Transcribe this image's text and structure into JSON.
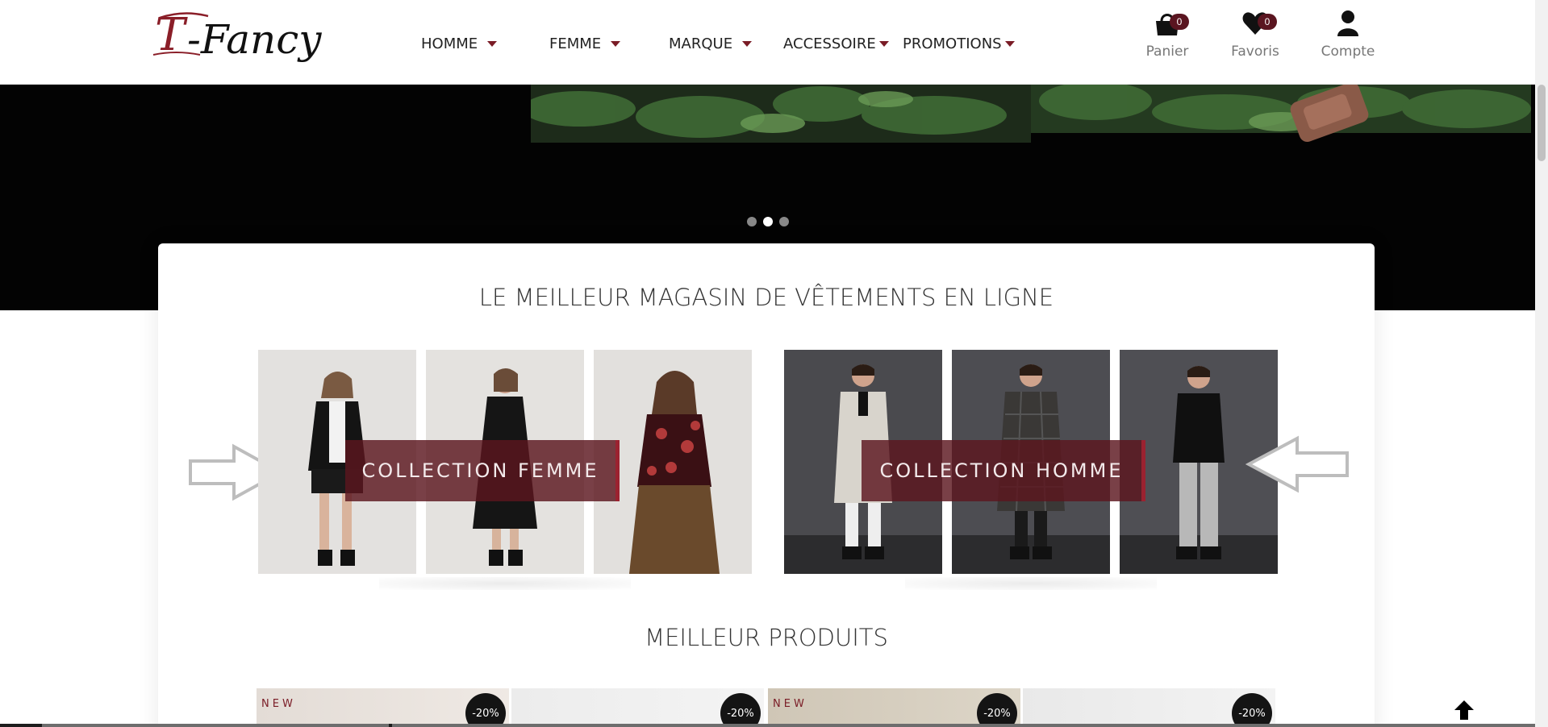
{
  "brand": {
    "logo_text": "T-Fancy",
    "accent": "#7a1c26"
  },
  "nav": {
    "items": [
      {
        "label": "HOMME",
        "icon": "caret-down-icon"
      },
      {
        "label": "FEMME",
        "icon": "caret-down-icon"
      },
      {
        "label": "MARQUE",
        "icon": "caret-down-icon"
      },
      {
        "label": "ACCESSOIRE",
        "icon": "caret-down-icon"
      },
      {
        "label": "PROMOTIONS",
        "icon": "caret-down-icon"
      }
    ]
  },
  "header_actions": {
    "cart": {
      "label": "Panier",
      "count": "0",
      "icon": "shopping-bag-icon"
    },
    "favorites": {
      "label": "Favoris",
      "count": "0",
      "icon": "heart-icon"
    },
    "account": {
      "label": "Compte",
      "icon": "user-icon"
    }
  },
  "slider": {
    "slide_count": 3,
    "active_index": 1
  },
  "main": {
    "section_title": "LE MEILLEUR MAGASIN DE VÊTEMENTS EN LIGNE",
    "collections": [
      {
        "label": "COLLECTION FEMME",
        "arrow_icon": "arrow-right-outline-icon"
      },
      {
        "label": "COLLECTION HOMME",
        "arrow_icon": "arrow-left-outline-icon"
      }
    ],
    "products_title": "MEILLEUR PRODUITS",
    "products": [
      {
        "tag": "NEW",
        "discount": "-20%"
      },
      {
        "tag": "",
        "discount": "-20%"
      },
      {
        "tag": "NEW",
        "discount": "-20%"
      },
      {
        "tag": "",
        "discount": "-20%"
      }
    ]
  },
  "back_to_top": {
    "icon": "arrow-up-icon"
  }
}
